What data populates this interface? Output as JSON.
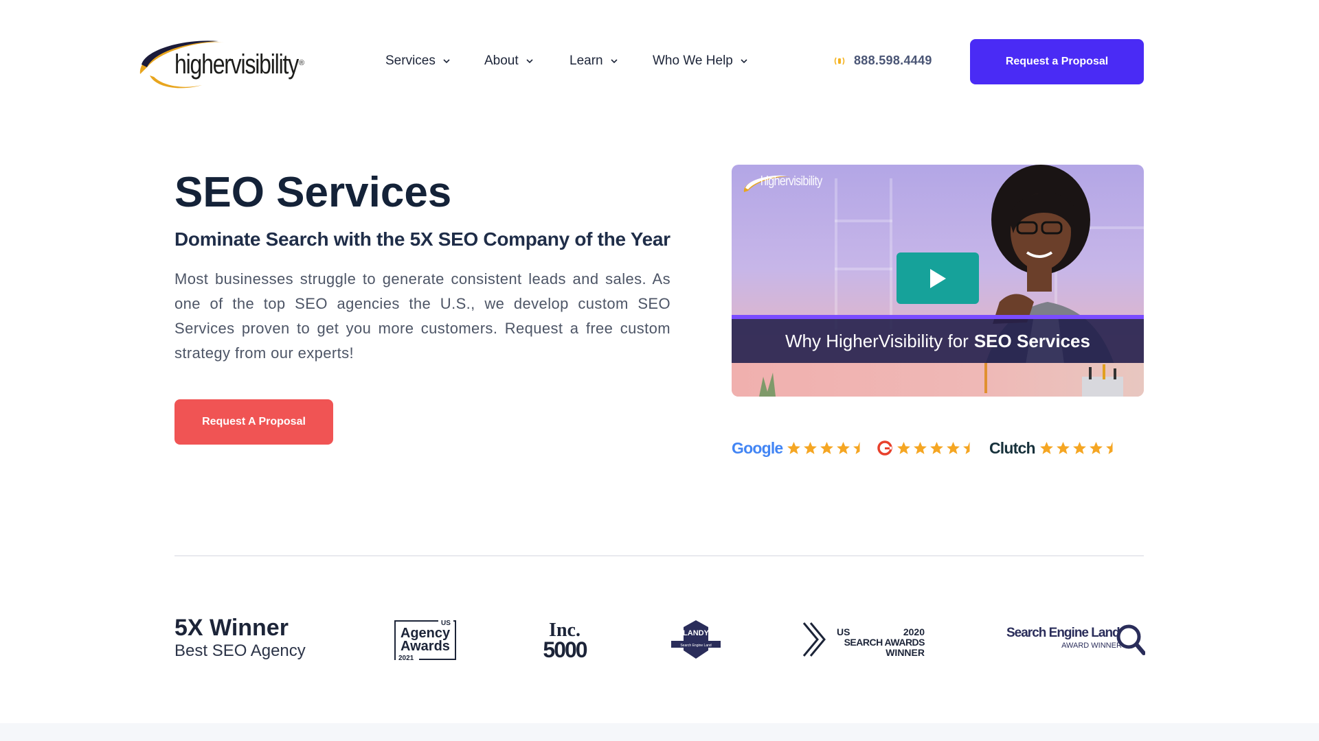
{
  "header": {
    "logo_text": "highervisibility",
    "logo_mark": "®",
    "nav": [
      {
        "label": "Services"
      },
      {
        "label": "About"
      },
      {
        "label": "Learn"
      },
      {
        "label": "Who We Help"
      }
    ],
    "phone": "888.598.4449",
    "cta_label": "Request a Proposal"
  },
  "hero": {
    "title_strong": "SEO",
    "title_rest": "Services",
    "subtitle": "Dominate Search with the 5X SEO Company of the Year",
    "body": "Most businesses struggle to generate consistent leads and sales. As one of the top SEO agencies the U.S., we develop custom SEO Services proven to get you more customers. Request a free custom strategy from our experts!",
    "cta_label": "Request A Proposal"
  },
  "video": {
    "logo_text": "highervisibility",
    "caption_light": "Why HigherVisibility for",
    "caption_strong": "SEO Services"
  },
  "ratings": [
    {
      "brand": "Google",
      "stars": 4.5
    },
    {
      "brand": "G2",
      "stars": 4.5
    },
    {
      "brand": "Clutch",
      "stars": 4.5
    }
  ],
  "awards": {
    "title": "5X Winner",
    "subtitle": "Best SEO Agency",
    "logos": {
      "agency_awards": {
        "line1": "Agency",
        "line2": "Awards",
        "year": "2021",
        "tag": "US"
      },
      "inc": {
        "line1": "Inc.",
        "line2": "5000"
      },
      "landy": {
        "label": "LANDY",
        "sub": "Search Engine Land"
      },
      "us_search": {
        "line1": "US",
        "line2": "SEARCH AWARDS",
        "line3": "WINNER",
        "year": "2020"
      },
      "sel": {
        "line1": "Search Engine Land",
        "line2": "AWARD WINNER"
      }
    }
  },
  "colors": {
    "primary": "#4a2bf5",
    "accent_red": "#f05454",
    "navy": "#142238",
    "star": "#f5a623",
    "play": "#16a29a"
  }
}
